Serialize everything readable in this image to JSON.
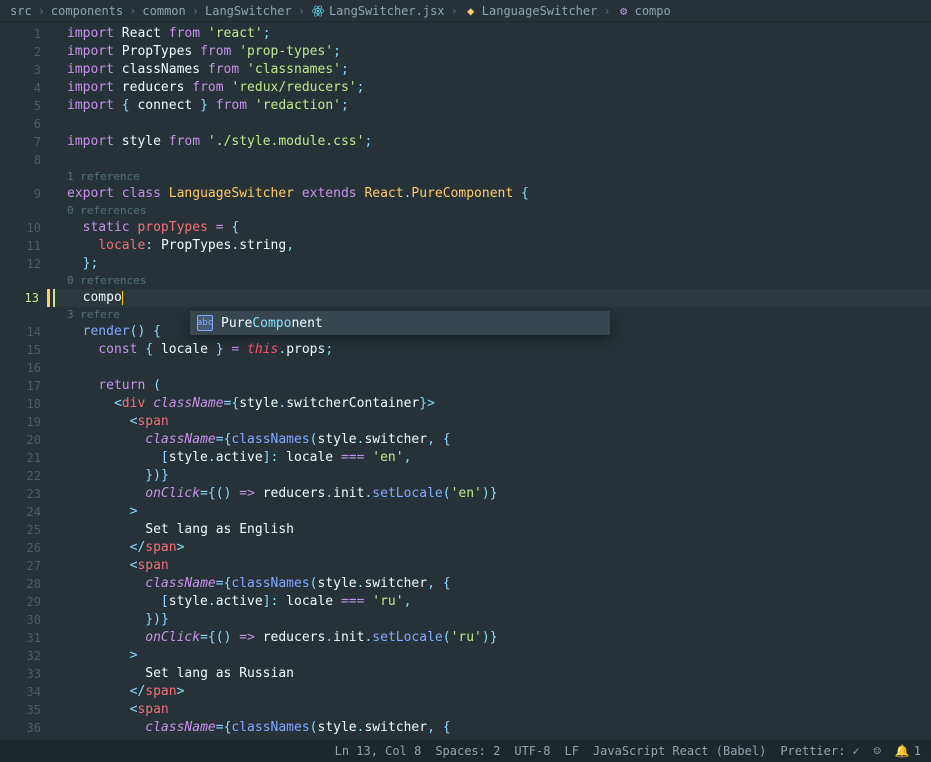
{
  "breadcrumb": [
    {
      "label": "src",
      "icon": null
    },
    {
      "label": "components",
      "icon": null
    },
    {
      "label": "common",
      "icon": null
    },
    {
      "label": "LangSwitcher",
      "icon": null
    },
    {
      "label": "LangSwitcher.jsx",
      "icon": "react"
    },
    {
      "label": "LanguageSwitcher",
      "icon": "symbol-class"
    },
    {
      "label": "compo",
      "icon": "symbol-method"
    }
  ],
  "codelens": {
    "l8a": "1 reference",
    "l9a": "0 references",
    "l12a": "0 references",
    "l13a": "3 refere"
  },
  "autocomplete": {
    "prefix": "Pure",
    "match": "Compo",
    "suffix": "nent"
  },
  "lines": {
    "l1": {
      "n": "1"
    },
    "l2": {
      "n": "2"
    },
    "l3": {
      "n": "3"
    },
    "l4": {
      "n": "4"
    },
    "l5": {
      "n": "5"
    },
    "l6": {
      "n": "6"
    },
    "l7": {
      "n": "7"
    },
    "l8": {
      "n": "8"
    },
    "l9": {
      "n": "9"
    },
    "l10": {
      "n": "10"
    },
    "l11": {
      "n": "11"
    },
    "l12": {
      "n": "12"
    },
    "l13": {
      "n": "13"
    },
    "l14": {
      "n": "14"
    },
    "l15": {
      "n": "15"
    },
    "l16": {
      "n": "16"
    },
    "l17": {
      "n": "17"
    },
    "l18": {
      "n": "18"
    },
    "l19": {
      "n": "19"
    },
    "l20": {
      "n": "20"
    },
    "l21": {
      "n": "21"
    },
    "l22": {
      "n": "22"
    },
    "l23": {
      "n": "23"
    },
    "l24": {
      "n": "24"
    },
    "l25": {
      "n": "25"
    },
    "l26": {
      "n": "26"
    },
    "l27": {
      "n": "27"
    },
    "l28": {
      "n": "28"
    },
    "l29": {
      "n": "29"
    },
    "l30": {
      "n": "30"
    },
    "l31": {
      "n": "31"
    },
    "l32": {
      "n": "32"
    },
    "l33": {
      "n": "33"
    },
    "l34": {
      "n": "34"
    },
    "l35": {
      "n": "35"
    },
    "l36": {
      "n": "36"
    }
  },
  "tokens": {
    "import": "import",
    "from": "from",
    "export": "export",
    "class": "class",
    "extends": "extends",
    "static": "static",
    "const": "const",
    "return": "return",
    "React": "React",
    "PropTypes": "PropTypes",
    "classNames": "classNames",
    "reducers": "reducers",
    "connect": "connect",
    "style": "style",
    "LanguageSwitcher": "LanguageSwitcher",
    "PureComponent": "PureComponent",
    "propTypes": "propTypes",
    "locale": "locale",
    "string": "string",
    "compo": "compo",
    "render": "render",
    "this": "this",
    "props": "props",
    "div": "div",
    "span": "span",
    "className": "className",
    "switcherContainer": "switcherContainer",
    "switcher": "switcher",
    "active": "active",
    "onClick": "onClick",
    "init": "init",
    "setLocale": "setLocale",
    "str_react": "'react'",
    "str_proptypes": "'prop-types'",
    "str_classnames": "'classnames'",
    "str_reducers": "'redux/reducers'",
    "str_redaction": "'redaction'",
    "str_style": "'./style.module.css'",
    "str_en": "'en'",
    "str_ru": "'ru'",
    "txt_en": "Set lang as English",
    "txt_ru": "Set lang as Russian",
    "eq": " = ",
    "eqeqeq": " === ",
    "arrow": " => ",
    "lbrace": "{",
    "rbrace": "}",
    "lparen": "(",
    "rparen": ")",
    "lbracket": "[",
    "rbracket": "]",
    "semi": ";",
    "comma": ",",
    "dot": ".",
    "lt": "<",
    "gt": ">",
    "slash": "/",
    "colon": ": "
  },
  "status": {
    "position": "Ln 13, Col 8",
    "spaces": "Spaces: 2",
    "encoding": "UTF-8",
    "eol": "LF",
    "language": "JavaScript React (Babel)",
    "prettier": "Prettier:",
    "notifications": "1"
  }
}
